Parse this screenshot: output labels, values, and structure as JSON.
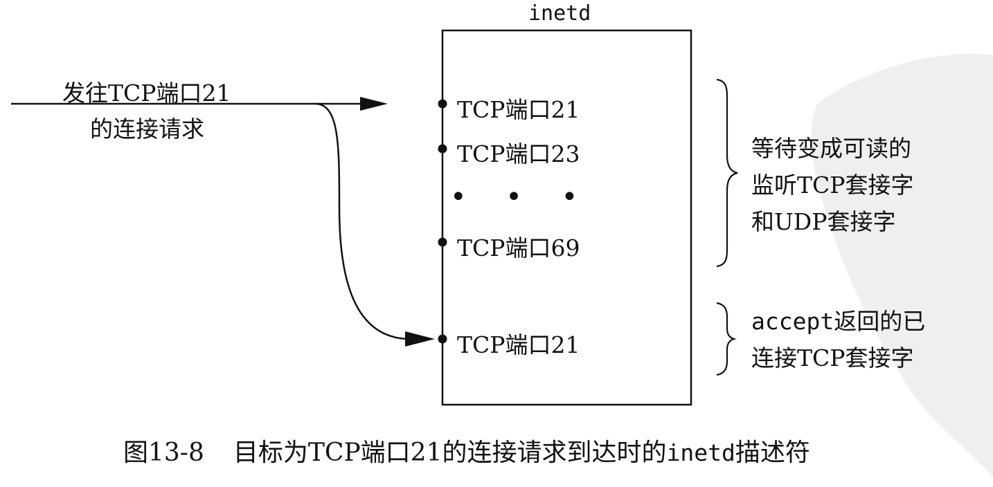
{
  "figure": {
    "box_title": "inetd",
    "incoming_label": [
      "发往TCP端口21",
      "的连接请求"
    ],
    "ports": [
      {
        "label": "TCP端口21"
      },
      {
        "label": "TCP端口23"
      },
      {
        "label": "TCP端口69"
      },
      {
        "label": "TCP端口21"
      }
    ],
    "ellipsis": "• • •",
    "listening_note": [
      "等待变成可读的",
      "监听TCP套接字",
      "和UDP套接字"
    ],
    "accepted_note": {
      "code": "accept",
      "line1_rest": "返回的已",
      "line2": "连接TCP套接字"
    }
  },
  "caption": {
    "number": "图13-8",
    "text": "目标为TCP端口21的连接请求到达时的",
    "code": "inetd",
    "suffix": "描述符"
  },
  "colors": {
    "ink": "#111111",
    "watermark": "#eeeeee"
  }
}
